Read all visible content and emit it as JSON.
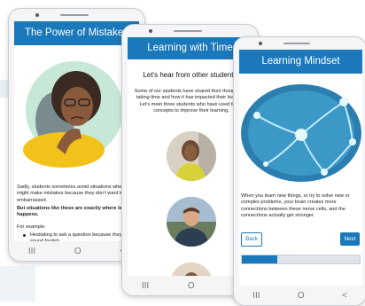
{
  "phone1": {
    "title": "The Power of Mistakes",
    "para1": "Sadly, students sometimes avoid situations where they might make mistakes because they don't want to feel embarrassed.",
    "para2": "But situations like these are exactly where learning happens.",
    "example_label": "For example:",
    "bullet1": "Hesitating to ask a question because they might sound foolish."
  },
  "phone2": {
    "title": "Learning with Time",
    "subtitle": "Let's hear from other students",
    "intro": "Some of our students have shared their thoughts on taking time and how it has impacted their learning. Let's meet three students who have used these concepts to improve their learning."
  },
  "phone3": {
    "title": "Learning Mindset",
    "body": "When you learn new things, or try to solve new or complex problems, your brain creates more connections between these nerve cells, and the connections actually get stronger.",
    "back_label": "Back",
    "next_label": "Next",
    "progress_fraction": 0.3
  },
  "nav": {
    "recents_glyph": "III",
    "home_glyph": "O",
    "back_glyph": "<"
  },
  "colors": {
    "brand_blue": "#1b78ba",
    "progress_track": "#dfe4ea"
  }
}
